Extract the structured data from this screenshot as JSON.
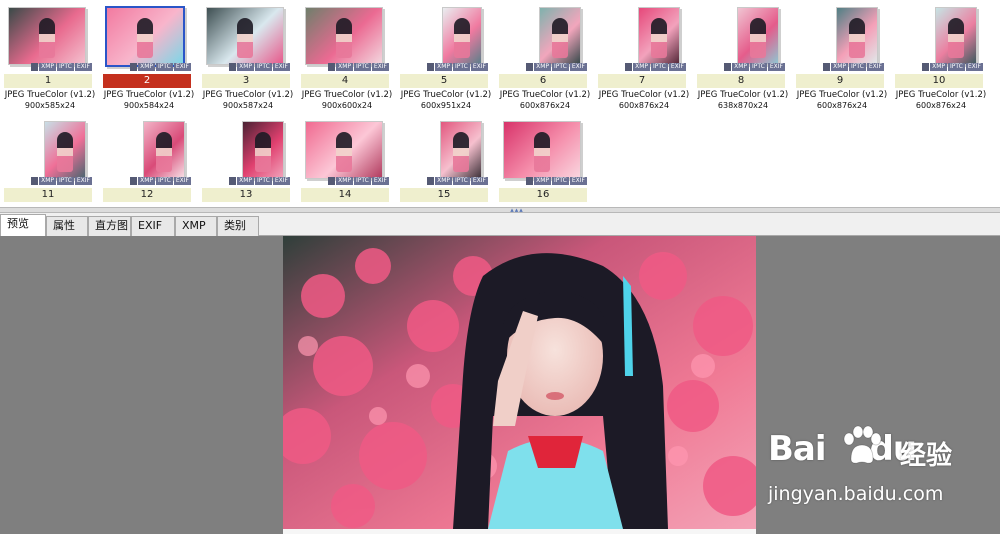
{
  "thumbnails": [
    {
      "num": "1",
      "format": "JPEG TrueColor (v1.2)",
      "dims": "900x585x24"
    },
    {
      "num": "2",
      "format": "JPEG TrueColor (v1.2)",
      "dims": "900x584x24",
      "selected": true
    },
    {
      "num": "3",
      "format": "JPEG TrueColor (v1.2)",
      "dims": "900x587x24"
    },
    {
      "num": "4",
      "format": "JPEG TrueColor (v1.2)",
      "dims": "900x600x24"
    },
    {
      "num": "5",
      "format": "JPEG TrueColor (v1.2)",
      "dims": "600x951x24"
    },
    {
      "num": "6",
      "format": "JPEG TrueColor (v1.2)",
      "dims": "600x876x24"
    },
    {
      "num": "7",
      "format": "JPEG TrueColor (v1.2)",
      "dims": "600x876x24"
    },
    {
      "num": "8",
      "format": "JPEG TrueColor (v1.2)",
      "dims": "638x870x24"
    },
    {
      "num": "9",
      "format": "JPEG TrueColor (v1.2)",
      "dims": "600x876x24"
    },
    {
      "num": "10",
      "format": "JPEG TrueColor (v1.2)",
      "dims": "600x876x24"
    },
    {
      "num": "11",
      "format": "",
      "dims": ""
    },
    {
      "num": "12",
      "format": "",
      "dims": ""
    },
    {
      "num": "13",
      "format": "",
      "dims": ""
    },
    {
      "num": "14",
      "format": "",
      "dims": ""
    },
    {
      "num": "15",
      "format": "",
      "dims": ""
    },
    {
      "num": "16",
      "format": "",
      "dims": ""
    }
  ],
  "badges": {
    "xmp": "XMP",
    "iptc": "IPTC",
    "exif": "EXIF"
  },
  "tabs": [
    {
      "label": "预览",
      "active": true
    },
    {
      "label": "属性"
    },
    {
      "label": "直方图"
    },
    {
      "label": "EXIF"
    },
    {
      "label": "XMP"
    },
    {
      "label": "类别"
    }
  ],
  "watermark": {
    "brand_bai": "Bai",
    "brand_du": "du",
    "brand_suffix": "经验",
    "url": "jingyan.baidu.com"
  },
  "colors": {
    "selected_number": "#c4301e",
    "number_bg": "#efefce",
    "preview_bg": "#7f7f7f",
    "selection_border": "#2a55c8"
  },
  "icons": {
    "splitter": "collapse-handle-icon",
    "paw": "baidu-paw-icon"
  }
}
